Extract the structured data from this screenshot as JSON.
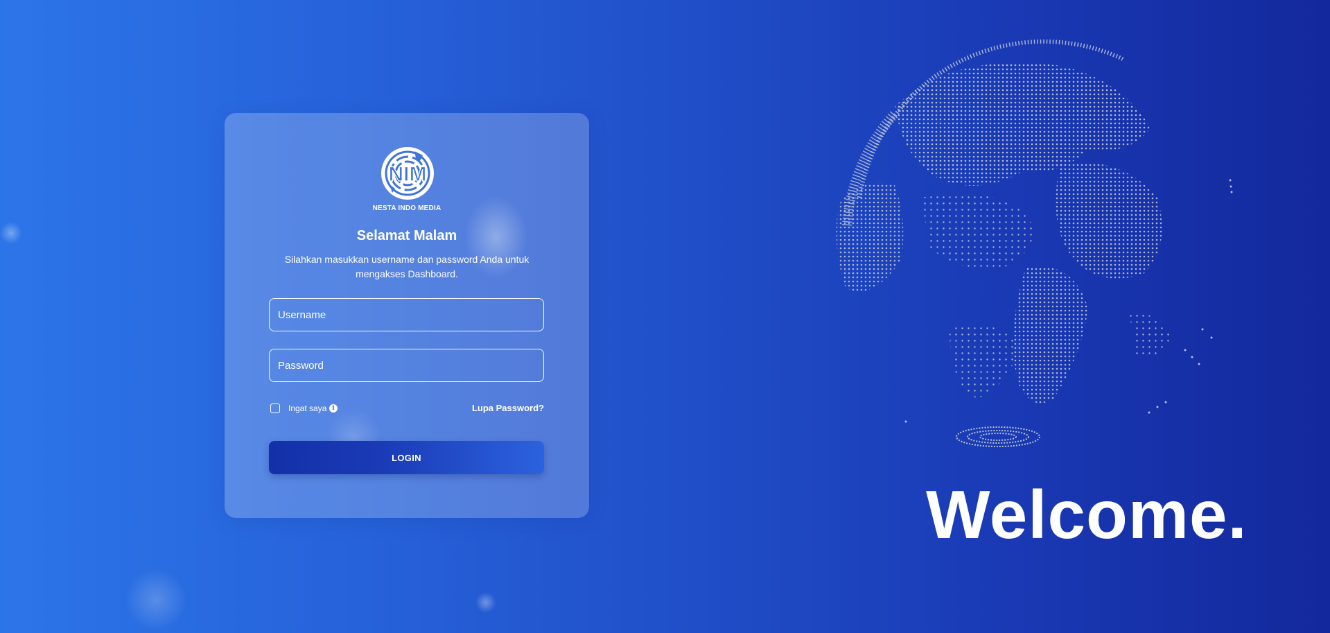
{
  "brand": {
    "logo_text": "NIM",
    "name": "NESTA INDO MEDIA"
  },
  "login": {
    "greeting": "Selamat Malam",
    "subtitle": "Silahkan masukkan username dan password Anda untuk mengakses Dashboard.",
    "username_placeholder": "Username",
    "password_placeholder": "Password",
    "remember_label": "Ingat saya",
    "info_icon": "info-icon",
    "forgot_label": "Lupa Password?",
    "login_label": "LOGIN"
  },
  "hero": {
    "welcome_text": "Welcome.",
    "globe_icon": "dotted-globe"
  },
  "colors": {
    "bg_start": "#2c75e8",
    "bg_end": "#13289c",
    "button_dark": "#1330a8",
    "globe_dots": "#b9c3d6"
  }
}
